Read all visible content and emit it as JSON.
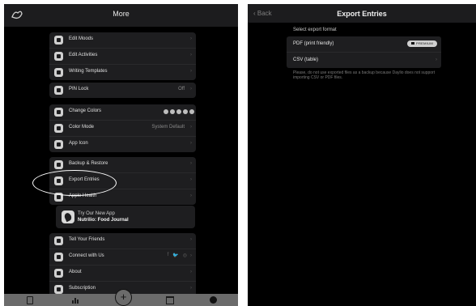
{
  "left": {
    "header": {
      "title": "More"
    },
    "groups": [
      {
        "items": [
          {
            "label": "Edit Moods"
          },
          {
            "label": "Edit Activities"
          },
          {
            "label": "Writing Templates"
          }
        ]
      },
      {
        "items": [
          {
            "label": "PIN Lock",
            "value": "Off"
          }
        ]
      },
      {
        "items": [
          {
            "label": "Change Colors"
          },
          {
            "label": "Color Mode",
            "value": "System Default"
          },
          {
            "label": "App Icon"
          }
        ]
      },
      {
        "items": [
          {
            "label": "Backup & Restore"
          },
          {
            "label": "Export Entries"
          },
          {
            "label": "Apple Health"
          }
        ]
      },
      {
        "items": [
          {
            "label": "Tell Your Friends"
          },
          {
            "label": "Connect with Us"
          },
          {
            "label": "About"
          },
          {
            "label": "Subscription"
          }
        ]
      }
    ],
    "promo": {
      "line1": "Try Our New App",
      "line2": "Nutrilio: Food Journal"
    },
    "chevron": "›",
    "socials": [
      "f",
      "🐦",
      "◎"
    ],
    "tabbar": {
      "add": "+"
    }
  },
  "right": {
    "header": {
      "back": "Back",
      "title": "Export Entries"
    },
    "section_label": "Select export format",
    "options": [
      {
        "label": "PDF (print friendly)",
        "badge": "PREMIUM"
      },
      {
        "label": "CSV (table)"
      }
    ],
    "note": "Please, do not use exported files as a backup because Daylio does not support importing CSV or PDF files."
  }
}
